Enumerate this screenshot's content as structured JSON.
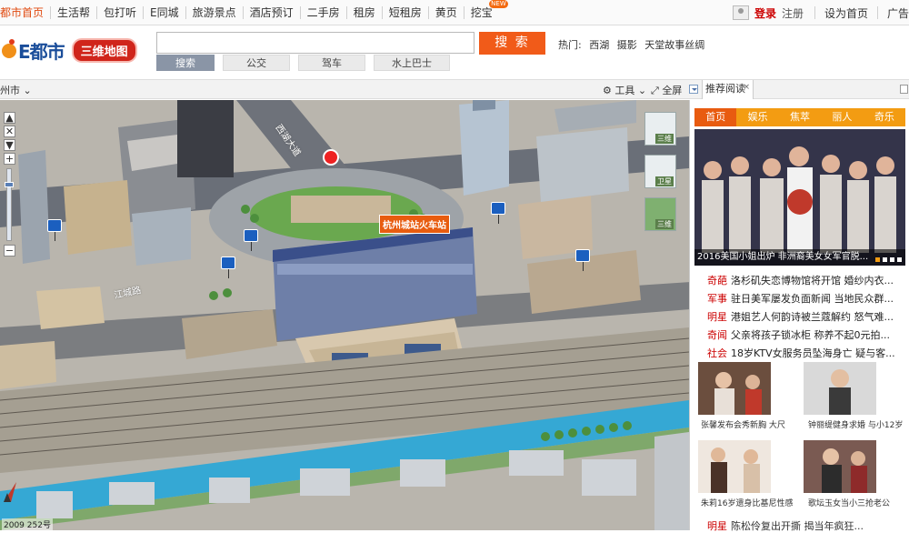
{
  "topnav": {
    "links": [
      "都市首页",
      "生活帮",
      "包打听",
      "E同城",
      "旅游景点",
      "酒店预订",
      "二手房",
      "租房",
      "短租房",
      "黄页",
      "挖宝"
    ],
    "new_badge": "NEW",
    "login": "登录",
    "register": "注册",
    "set_home": "设为首页",
    "ad": "广告"
  },
  "header": {
    "logo_text": "E都市",
    "logo_tag": "三维地图",
    "search_value": "",
    "search_button": "搜 索",
    "hot_label": "热门:",
    "hot_items": [
      "西湖",
      "摄影",
      "天堂故事丝绸"
    ],
    "search_tabs": [
      "搜索",
      "公交",
      "驾车",
      "水上巴士"
    ]
  },
  "toolbar": {
    "city": "州市",
    "tools": "工具",
    "fullscreen": "全屏",
    "recommend_tab": "推荐阅读",
    "close": "×"
  },
  "map": {
    "station_label": "杭州城站火车站",
    "road_labels": [
      "江城路",
      "西湖大道"
    ],
    "scale_text": "2009 252号",
    "view_buttons": [
      "三维",
      "卫星",
      "三维"
    ],
    "zoom_in": "+",
    "zoom_out": "−"
  },
  "sidebar": {
    "cat_tabs": [
      "首页",
      "娱乐",
      "焦萃",
      "丽人",
      "奇乐"
    ],
    "hero_caption": "2016美国小姐出炉 非洲裔美女女军官脱...",
    "news": [
      {
        "cat": "奇葩",
        "title": "洛杉矶失恋博物馆将开馆 婚纱内衣..."
      },
      {
        "cat": "军事",
        "title": "驻日美军屡发负面新闻 当地民众群..."
      },
      {
        "cat": "明星",
        "title": "港姐艺人何韵诗被兰蔻解约 怒气难..."
      },
      {
        "cat": "奇闻",
        "title": "父亲将孩子锁冰柜 称养不起0元拍..."
      },
      {
        "cat": "社会",
        "title": "18岁KTV女服务员坠海身亡 疑与客..."
      }
    ],
    "thumbs": [
      {
        "caption": "张馨发布会秀新胸 大尺"
      },
      {
        "caption": "钟丽缇健身求婚 与小12岁"
      },
      {
        "caption": "朱莉16岁遗身比基尼性感"
      },
      {
        "caption": "歌坛玉女当小三抢老公"
      }
    ],
    "bottom_news": {
      "cat": "明星",
      "title": "陈松伶复出开撕 揭当年疯狂..."
    }
  }
}
